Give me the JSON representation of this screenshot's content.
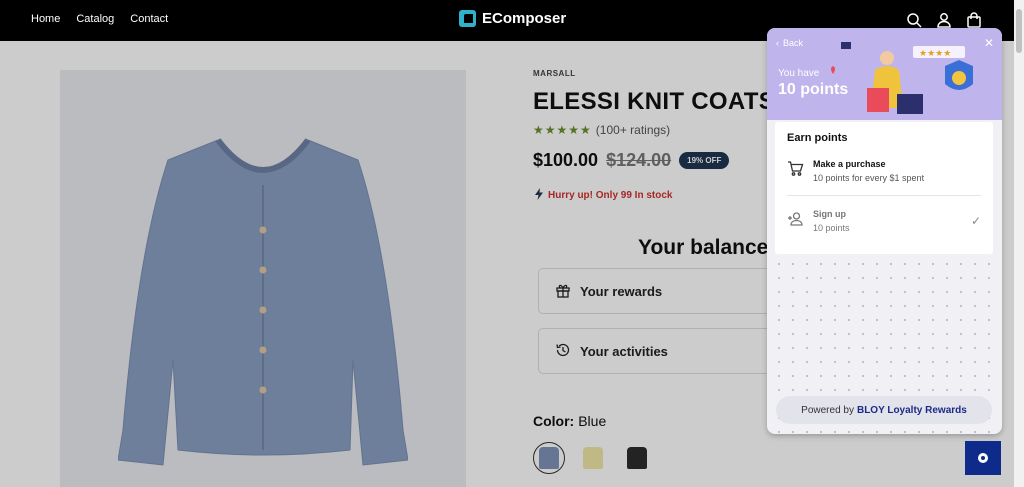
{
  "header": {
    "nav": [
      "Home",
      "Catalog",
      "Contact"
    ],
    "logo_text": "EComposer"
  },
  "product": {
    "brand": "MARSALL",
    "title": "ELESSI KNIT COATS",
    "stars": "★★★★★",
    "ratings_text": "(100+ ratings)",
    "price": "$100.00",
    "old_price": "$124.00",
    "discount_badge": "19% OFF",
    "stock_text": "Hurry up! Only 99 In stock",
    "color_label": "Color:",
    "color_value": "Blue",
    "swatch_colors": [
      "#7f93b8",
      "#f0e8a8",
      "#2c2c2c"
    ]
  },
  "balance": {
    "title": "Your balance",
    "rewards_label": "Your rewards",
    "activities_label": "Your activities"
  },
  "loyalty": {
    "back_label": "Back",
    "you_have": "You have",
    "points": "10 points",
    "earn_title": "Earn points",
    "earn_items": [
      {
        "title": "Make a purchase",
        "subtitle": "10 points for every $1 spent"
      },
      {
        "title": "Sign up",
        "subtitle": "10 points"
      }
    ],
    "powered_prefix": "Powered by",
    "powered_brand": "BLOY Loyalty Rewards"
  },
  "colors": {
    "accent": "#1f3650",
    "stock_red": "#d0312d",
    "launcher": "#0e2a8a",
    "banner": "#bfb4ec"
  }
}
